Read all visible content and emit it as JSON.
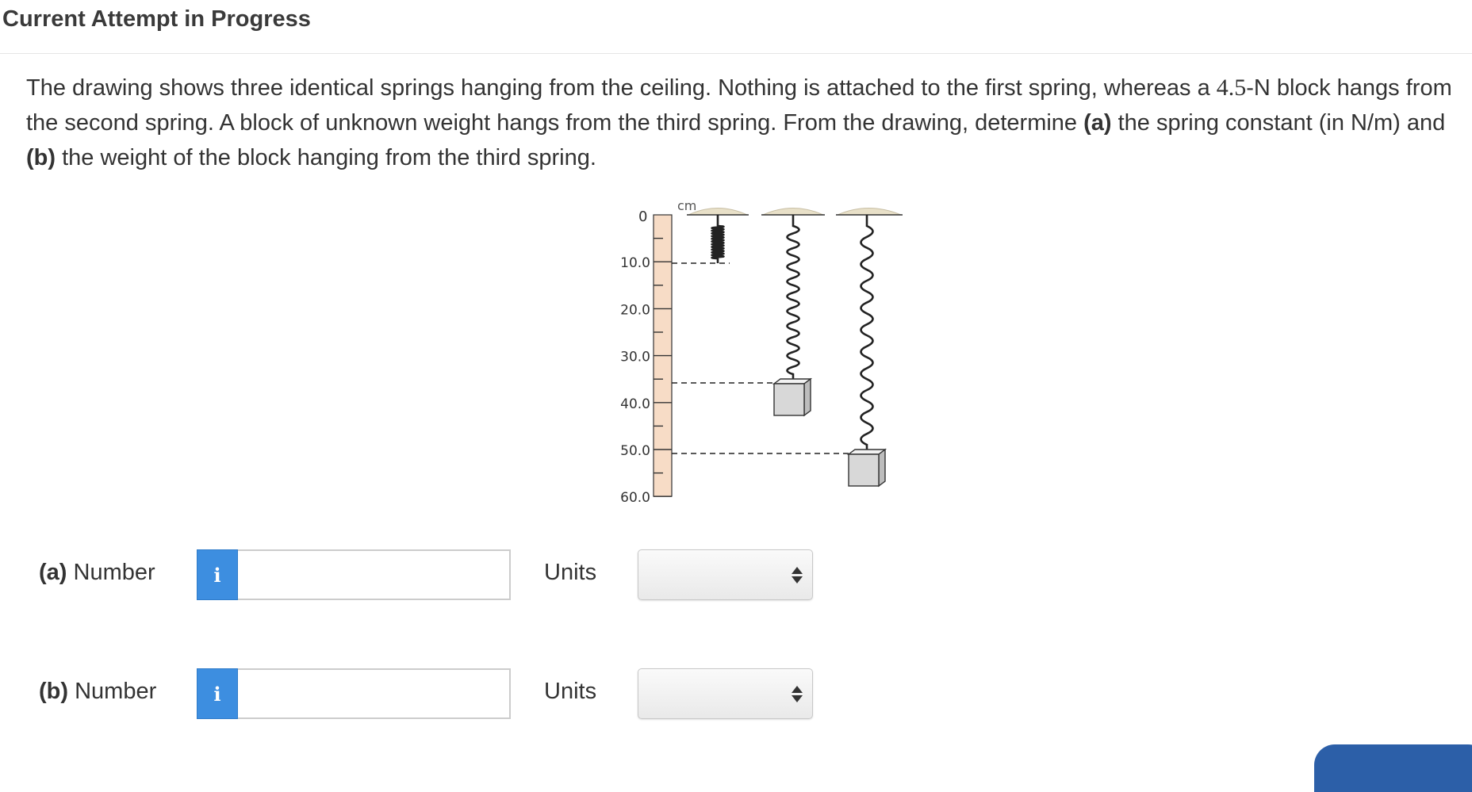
{
  "header": {
    "title": "Current Attempt in Progress"
  },
  "question": {
    "text_1": "The drawing shows three identical springs hanging from the ceiling. Nothing is attached to the first spring, whereas a ",
    "weight_value": "4.5",
    "text_2": "-N block hangs from the second spring. A block of unknown weight hangs from the third spring. From the drawing, determine ",
    "part_a_tag": "(a)",
    "text_3": " the spring constant (in N/m) and ",
    "part_b_tag": "(b)",
    "text_4": " the weight of the block hanging from the third spring."
  },
  "figure": {
    "ruler_unit": "cm",
    "ruler_zero": "0",
    "tick_labels": [
      "10.0",
      "20.0",
      "30.0",
      "40.0",
      "50.0",
      "60.0"
    ],
    "colors": {
      "ruler": "#f7dcc6",
      "ceiling": "#e8e0c8",
      "block": "#d8d8d8"
    }
  },
  "answers": [
    {
      "tag": "(a)",
      "label": " Number",
      "info_icon": "i",
      "value": "",
      "units_label": "Units",
      "units_value": ""
    },
    {
      "tag": "(b)",
      "label": " Number",
      "info_icon": "i",
      "value": "",
      "units_label": "Units",
      "units_value": ""
    }
  ],
  "colors": {
    "accent": "#3d8ee0",
    "submit": "#2c5fa8"
  }
}
